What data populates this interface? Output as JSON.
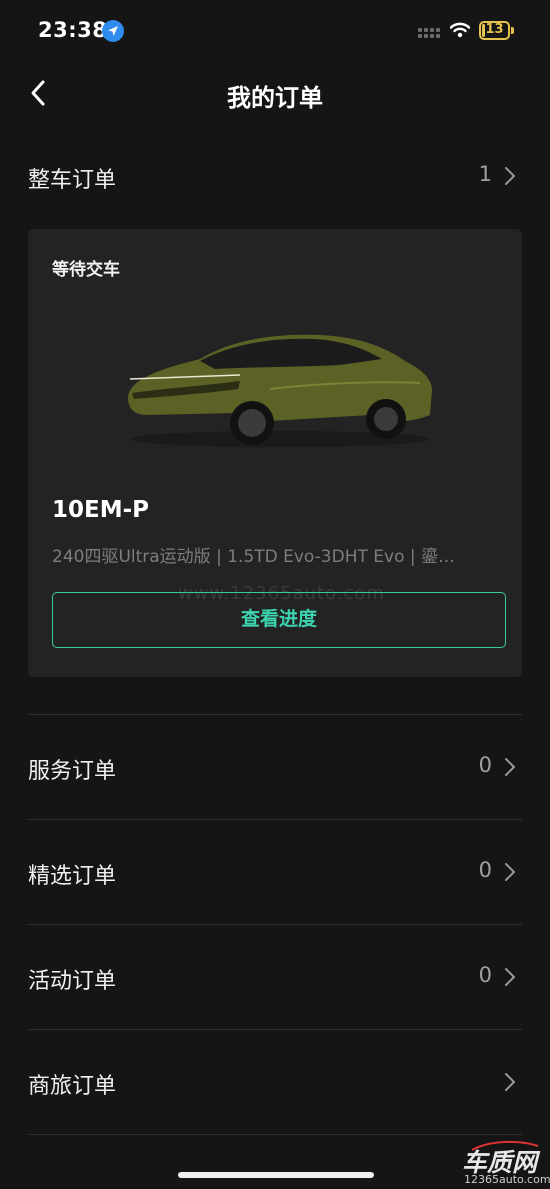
{
  "status_bar": {
    "time": "23:38",
    "battery": "13",
    "battery_color": "#e6c34d",
    "location_icon": "location-arrow-icon",
    "wifi_icon": "wifi-icon"
  },
  "header": {
    "title": "我的订单",
    "back_icon": "chevron-left-icon"
  },
  "vehicle_orders": {
    "label": "整车订单",
    "count": "1"
  },
  "order_card": {
    "status": "等待交车",
    "car_name": "10EM-P",
    "car_spec": "240四驱Ultra运动版 | 1.5TD Evo-3DHT Evo | 鎏…",
    "watermark": "www.12365auto.com",
    "button_label": "查看进度",
    "accent_color": "#3cd3af"
  },
  "order_sections": [
    {
      "label": "服务订单",
      "count": "0"
    },
    {
      "label": "精选订单",
      "count": "0"
    },
    {
      "label": "活动订单",
      "count": "0"
    },
    {
      "label": "商旅订单",
      "count": ""
    }
  ],
  "brand": {
    "name": "车质网",
    "url": "12365auto.com"
  }
}
